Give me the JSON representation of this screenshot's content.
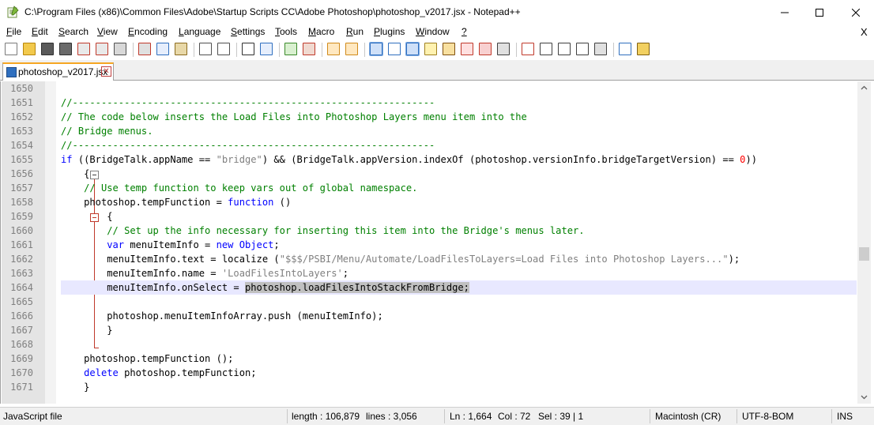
{
  "window": {
    "title": "C:\\Program Files (x86)\\Common Files\\Adobe\\Startup Scripts CC\\Adobe Photoshop\\photoshop_v2017.jsx - Notepad++",
    "icons": [
      "notepadpp-icon",
      "minimize-icon",
      "maximize-icon",
      "close-icon"
    ]
  },
  "menu": {
    "items": [
      {
        "label": "File",
        "u": "F",
        "rest": "ile"
      },
      {
        "label": "Edit",
        "u": "E",
        "rest": "dit"
      },
      {
        "label": "Search",
        "u": "S",
        "rest": "earch"
      },
      {
        "label": "View",
        "u": "V",
        "rest": "iew"
      },
      {
        "label": "Encoding",
        "u": "E",
        "rest": "ncoding"
      },
      {
        "label": "Language",
        "u": "L",
        "rest": "anguage"
      },
      {
        "label": "Settings",
        "u": "S",
        "rest": "ettings"
      },
      {
        "label": "Tools",
        "u": "T",
        "rest": "ools"
      },
      {
        "label": "Macro",
        "u": "M",
        "rest": "acro"
      },
      {
        "label": "Run",
        "u": "R",
        "rest": "un"
      },
      {
        "label": "Plugins",
        "u": "P",
        "rest": "lugins"
      },
      {
        "label": "Window",
        "u": "W",
        "rest": "indow"
      },
      {
        "label": "?",
        "u": "?",
        "rest": ""
      }
    ],
    "close_doc": "X"
  },
  "tabs": [
    {
      "label": "photoshop_v2017.jsx",
      "active": true
    }
  ],
  "editor": {
    "lines": [
      {
        "n": "1650",
        "code": ""
      },
      {
        "n": "1651",
        "code": "//---------------------------------------------------------------"
      },
      {
        "n": "1652",
        "code": "// The code below inserts the Load Files into Photoshop Layers menu item into the"
      },
      {
        "n": "1653",
        "code": "// Bridge menus."
      },
      {
        "n": "1654",
        "code": "//---------------------------------------------------------------"
      },
      {
        "n": "1655",
        "code": "if ((BridgeTalk.appName == \"bridge\") && (BridgeTalk.appVersion.indexOf (photoshop.versionInfo.bridgeTargetVersion) == 0))"
      },
      {
        "n": "1656",
        "code": "    {"
      },
      {
        "n": "1657",
        "code": "    // Use temp function to keep vars out of global namespace."
      },
      {
        "n": "1658",
        "code": "    photoshop.tempFunction = function ()"
      },
      {
        "n": "1659",
        "code": "        {"
      },
      {
        "n": "1660",
        "code": "        // Set up the info necessary for inserting this item into the Bridge's menus later."
      },
      {
        "n": "1661",
        "code": "        var menuItemInfo = new Object;"
      },
      {
        "n": "1662",
        "code": "        menuItemInfo.text = localize (\"$$$/PSBI/Menu/Automate/LoadFilesToLayers=Load Files into Photoshop Layers...\");"
      },
      {
        "n": "1663",
        "code": "        menuItemInfo.name = 'LoadFilesIntoLayers';"
      },
      {
        "n": "1664",
        "code": "        menuItemInfo.onSelect = photoshop.loadFilesIntoStackFromBridge;"
      },
      {
        "n": "1665",
        "code": ""
      },
      {
        "n": "1666",
        "code": "        photoshop.menuItemInfoArray.push (menuItemInfo);"
      },
      {
        "n": "1667",
        "code": "        }"
      },
      {
        "n": "1668",
        "code": ""
      },
      {
        "n": "1669",
        "code": "    photoshop.tempFunction ();"
      },
      {
        "n": "1670",
        "code": "    delete photoshop.tempFunction;"
      },
      {
        "n": "1671",
        "code": "    }"
      }
    ],
    "selection": "photoshop.loadFilesIntoStackFromBridge;"
  },
  "status": {
    "file_type": "JavaScript file",
    "length": "length : 106,879",
    "lines": "lines : 3,056",
    "ln": "Ln : 1,664",
    "col": "Col : 72",
    "sel": "Sel : 39 | 1",
    "eol": "Macintosh (CR)",
    "encoding": "UTF-8-BOM",
    "mode": "INS"
  },
  "colors": {
    "comment": "#008000",
    "keyword": "#0000ff",
    "string": "#808080",
    "number": "#ff0000",
    "current_line": "#e8e8ff",
    "tab_accent": "#f5a623"
  }
}
